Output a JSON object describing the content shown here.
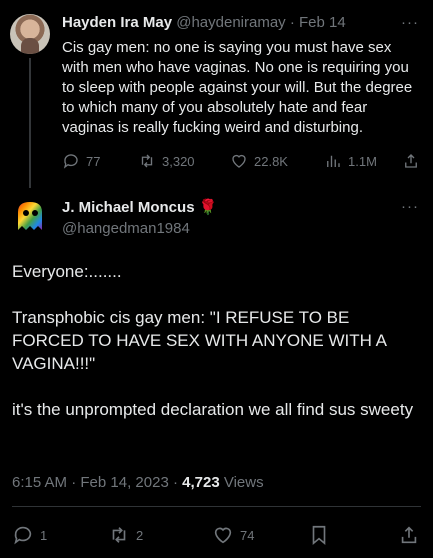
{
  "parent_tweet": {
    "display_name": "Hayden Ira May",
    "handle": "@haydeniramay",
    "separator": "·",
    "date": "Feb 14",
    "more": "···",
    "text": "Cis gay men: no one is saying you must have sex with men who have vaginas. No one is requiring you to sleep with people against your will. But the degree to which many of you absolutely hate and fear vaginas is really fucking weird and disturbing.",
    "replies": "77",
    "retweets": "3,320",
    "likes": "22.8K",
    "views": "1.1M"
  },
  "main_tweet": {
    "display_name": "J. Michael Moncus",
    "name_emoji": "🌹",
    "handle": "@hangedman1984",
    "more": "···",
    "paragraphs": [
      "Everyone:.......",
      "Transphobic cis gay men: \"I REFUSE TO BE FORCED TO HAVE SEX WITH ANYONE WITH A VAGINA!!!\"",
      "it's the unprompted declaration we all find sus sweety"
    ],
    "time": "6:15 AM",
    "date": "Feb 14, 2023",
    "views_count": "4,723",
    "views_label": "Views",
    "replies": "1",
    "retweets": "2",
    "likes": "74"
  },
  "colors": {
    "background": "#000000",
    "text": "#e7e9ea",
    "muted": "#71767b",
    "divider": "#2f3336"
  }
}
